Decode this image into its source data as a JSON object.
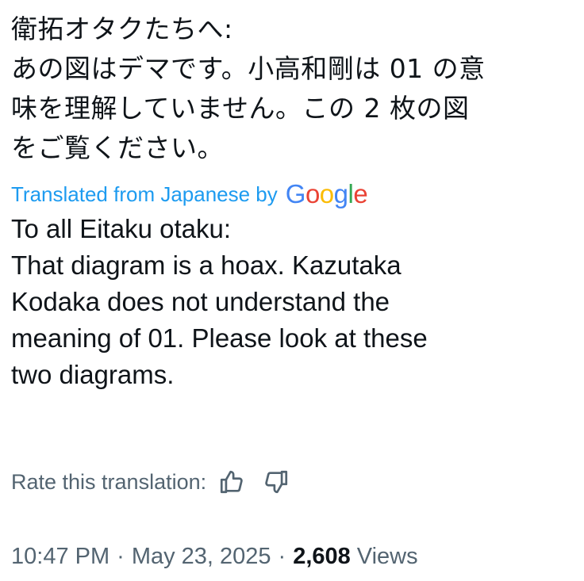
{
  "tweet": {
    "original_lines": [
      "衛拓オタクたちへ:",
      "あの図はデマです。小高和剛は 01 の意",
      "味を理解していません。この 2 枚の図",
      "をご覧ください。"
    ],
    "translated_label": "Translated from Japanese by",
    "google_logo": {
      "letters": [
        "G",
        "o",
        "o",
        "g",
        "l",
        "e"
      ],
      "colors": [
        "#4285f4",
        "#ea4335",
        "#fbbc05",
        "#4285f4",
        "#34a853",
        "#ea4335"
      ]
    },
    "translation_lines": [
      "To all Eitaku otaku:",
      "That diagram is a hoax. Kazutaka",
      "Kodaka does not understand the",
      "meaning of 01. Please look at these",
      "two diagrams."
    ]
  },
  "rating": {
    "label": "Rate this translation:",
    "thumbs_up_icon": "thumbs-up-icon",
    "thumbs_down_icon": "thumbs-down-icon"
  },
  "meta": {
    "time": "10:47 PM",
    "separator": "·",
    "date": "May 23, 2025",
    "views_count": "2,608",
    "views_label": "Views"
  },
  "colors": {
    "text": "#0f1419",
    "secondary": "#536471",
    "link": "#1d9bf0"
  }
}
